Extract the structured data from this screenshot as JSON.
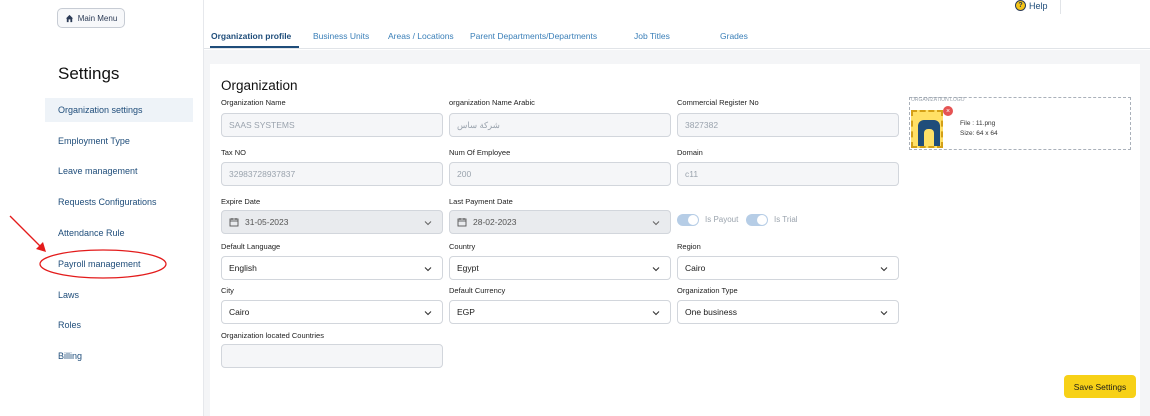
{
  "header": {
    "main_menu_label": "Main Menu",
    "help_label": "Help"
  },
  "sidebar": {
    "title": "Settings",
    "items": [
      {
        "label": "Organization settings",
        "active": true
      },
      {
        "label": "Employment Type"
      },
      {
        "label": "Leave management"
      },
      {
        "label": "Requests Configurations"
      },
      {
        "label": "Attendance Rule"
      },
      {
        "label": "Payroll management"
      },
      {
        "label": "Laws"
      },
      {
        "label": "Roles"
      },
      {
        "label": "Billing"
      }
    ]
  },
  "tabs": [
    "Organization profile",
    "Business Units",
    "Areas / Locations",
    "Parent Departments/Departments",
    "Job Titles",
    "Grades"
  ],
  "form": {
    "title": "Organization",
    "org_name": {
      "label": "Organization Name",
      "value": "SAAS SYSTEMS"
    },
    "org_name_ar": {
      "label": "organization Name Arabic",
      "value": "شركة ساس"
    },
    "commercial_reg": {
      "label": "Commercial Register No",
      "value": "3827382"
    },
    "tax_no": {
      "label": "Tax NO",
      "value": "32983728937837"
    },
    "num_employee": {
      "label": "Num Of Employee",
      "value": "200"
    },
    "domain": {
      "label": "Domain",
      "value": "c11"
    },
    "expire_date": {
      "label": "Expire Date",
      "value": "31-05-2023"
    },
    "last_payment": {
      "label": "Last Payment Date",
      "value": "28-02-2023"
    },
    "is_payout": {
      "label": "Is Payout",
      "checked": true
    },
    "is_trial": {
      "label": "Is Trial",
      "checked": true
    },
    "default_language": {
      "label": "Default Language",
      "value": "English"
    },
    "country": {
      "label": "Country",
      "value": "Egypt"
    },
    "region": {
      "label": "Region",
      "value": "Cairo"
    },
    "city": {
      "label": "City",
      "value": "Cairo"
    },
    "currency": {
      "label": "Default Currency",
      "value": "EGP"
    },
    "org_type": {
      "label": "Organization Type",
      "value": "One business"
    },
    "located_countries": {
      "label": "Organization located Countries",
      "value": ""
    }
  },
  "logo": {
    "caption": "ORGANIZATION LOGO",
    "file": "File : 11.png",
    "size": "Size: 64 x 64"
  },
  "save_label": "Save Settings",
  "colors": {
    "accent": "#1f4d7a",
    "link": "#3a7fb8",
    "save": "#f7d117",
    "annotation": "#e31b1b"
  }
}
